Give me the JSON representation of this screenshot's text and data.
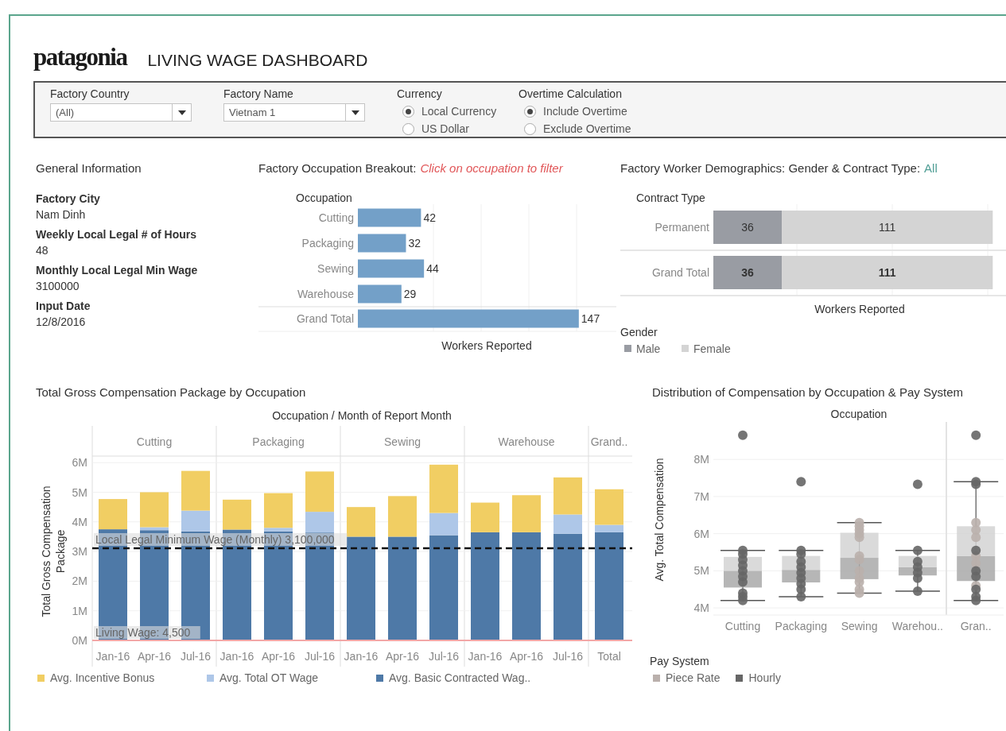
{
  "header": {
    "logo": "patagonia",
    "title": "LIVING WAGE DASHBOARD"
  },
  "filters": [
    {
      "kind": "dropdown",
      "label": "Factory Country",
      "value": "(All)"
    },
    {
      "kind": "dropdown",
      "label": "Factory Name",
      "value": "Vietnam 1"
    },
    {
      "kind": "radio",
      "label": "Currency",
      "options": [
        {
          "label": "Local Currency",
          "selected": true
        },
        {
          "label": "US Dollar",
          "selected": false
        }
      ]
    },
    {
      "kind": "radio",
      "label": "Overtime Calculation",
      "options": [
        {
          "label": "Include Overtime",
          "selected": true
        },
        {
          "label": "Exclude Overtime",
          "selected": false
        }
      ]
    }
  ],
  "general_info": {
    "title": "General Information",
    "fields": [
      {
        "label": "Factory City",
        "value": "Nam Dinh"
      },
      {
        "label": "Weekly Local Legal # of Hours",
        "value": "48"
      },
      {
        "label": "Monthly Local Legal Min Wage",
        "value": "3100000"
      },
      {
        "label": "Input Date",
        "value": "12/8/2016"
      }
    ]
  },
  "occupation_breakout": {
    "title": "Factory Occupation Breakout:",
    "hint": "Click on occupation to filter",
    "chart_data": {
      "type": "bar",
      "orientation": "horizontal",
      "ylabel": "Occupation",
      "xlabel": "Workers Reported",
      "categories": [
        "Cutting",
        "Packaging",
        "Sewing",
        "Warehouse",
        "Grand Total"
      ],
      "values": [
        42,
        32,
        44,
        29,
        147
      ],
      "data_labels": true
    }
  },
  "demographics": {
    "title": "Factory Worker Demographics: Gender & Contract Type:",
    "filter_value": "All",
    "chart_data": {
      "type": "bar",
      "orientation": "horizontal",
      "stacked": true,
      "ylabel": "Contract Type",
      "xlabel": "Workers Reported",
      "categories": [
        "Permanent",
        "Grand Total"
      ],
      "series": [
        {
          "name": "Male",
          "color": "#999ca3",
          "values": [
            36,
            36
          ]
        },
        {
          "name": "Female",
          "color": "#d4d4d4",
          "values": [
            111,
            111
          ]
        }
      ],
      "data_labels": true,
      "legend": {
        "title": "Gender"
      }
    }
  },
  "compensation": {
    "title": "Total Gross Compensation Package by Occupation",
    "panes": [
      "Cutting",
      "Packaging",
      "Sewing",
      "Warehouse",
      "Grand.."
    ],
    "chart_data": {
      "type": "bar",
      "stacked": true,
      "grid": true,
      "xlabel": "Occupation / Month of Report Month",
      "ylabel": "Total Gross Compensation Package",
      "categories": [
        "Jan-16",
        "Apr-16",
        "Jul-16",
        "Jan-16",
        "Apr-16",
        "Jul-16",
        "Jan-16",
        "Apr-16",
        "Jul-16",
        "Jan-16",
        "Apr-16",
        "Jul-16",
        "Total"
      ],
      "ylim": [
        0,
        6.22
      ],
      "yticks": [
        {
          "value": 0,
          "label": "0M"
        },
        {
          "value": 1,
          "label": "1M"
        },
        {
          "value": 2,
          "label": "2M"
        },
        {
          "value": 3,
          "label": "3M"
        },
        {
          "value": 4,
          "label": "4M"
        },
        {
          "value": 5,
          "label": "5M"
        },
        {
          "value": 6,
          "label": "6M"
        }
      ],
      "series": [
        {
          "name": "Avg. Basic Contracted Wag..",
          "color": "#4e79a7",
          "values": [
            3.75,
            3.72,
            3.68,
            3.74,
            3.68,
            3.64,
            3.5,
            3.5,
            3.55,
            3.65,
            3.65,
            3.6,
            3.65
          ]
        },
        {
          "name": "Avg. Total OT Wage",
          "color": "#aec7e8",
          "values": [
            0,
            0.1,
            0.7,
            0,
            0.12,
            0.7,
            0,
            0,
            0.75,
            0,
            0,
            0.65,
            0.25
          ]
        },
        {
          "name": "Avg. Incentive Bonus",
          "color": "#f1ce63",
          "values": [
            1.02,
            1.18,
            1.34,
            1.01,
            1.17,
            1.36,
            1.0,
            1.37,
            1.63,
            1.0,
            1.25,
            1.25,
            1.2
          ]
        }
      ],
      "ref_lines": [
        {
          "axis": "y",
          "value": 3.1,
          "label": "Local Legal Minimum Wage (Monthly) 3,100,000",
          "color": "#111111"
        }
      ]
    },
    "baseline_label": "Living Wage: 4,500"
  },
  "distribution": {
    "title": "Distribution of Compensation by Occupation & Pay System",
    "legend": {
      "title": "Pay System",
      "items": [
        {
          "name": "Piece Rate",
          "color": "#bab0ac"
        },
        {
          "name": "Hourly",
          "color": "#666666"
        }
      ]
    },
    "plot": {
      "xlabel": "Occupation",
      "ylabel": "Avg. Total Compensation",
      "categories": [
        "Cutting",
        "Packaging",
        "Sewing",
        "Warehou..",
        "Gran.."
      ],
      "yticks": [
        "8M",
        "7M",
        "6M",
        "5M",
        "4M"
      ]
    }
  }
}
